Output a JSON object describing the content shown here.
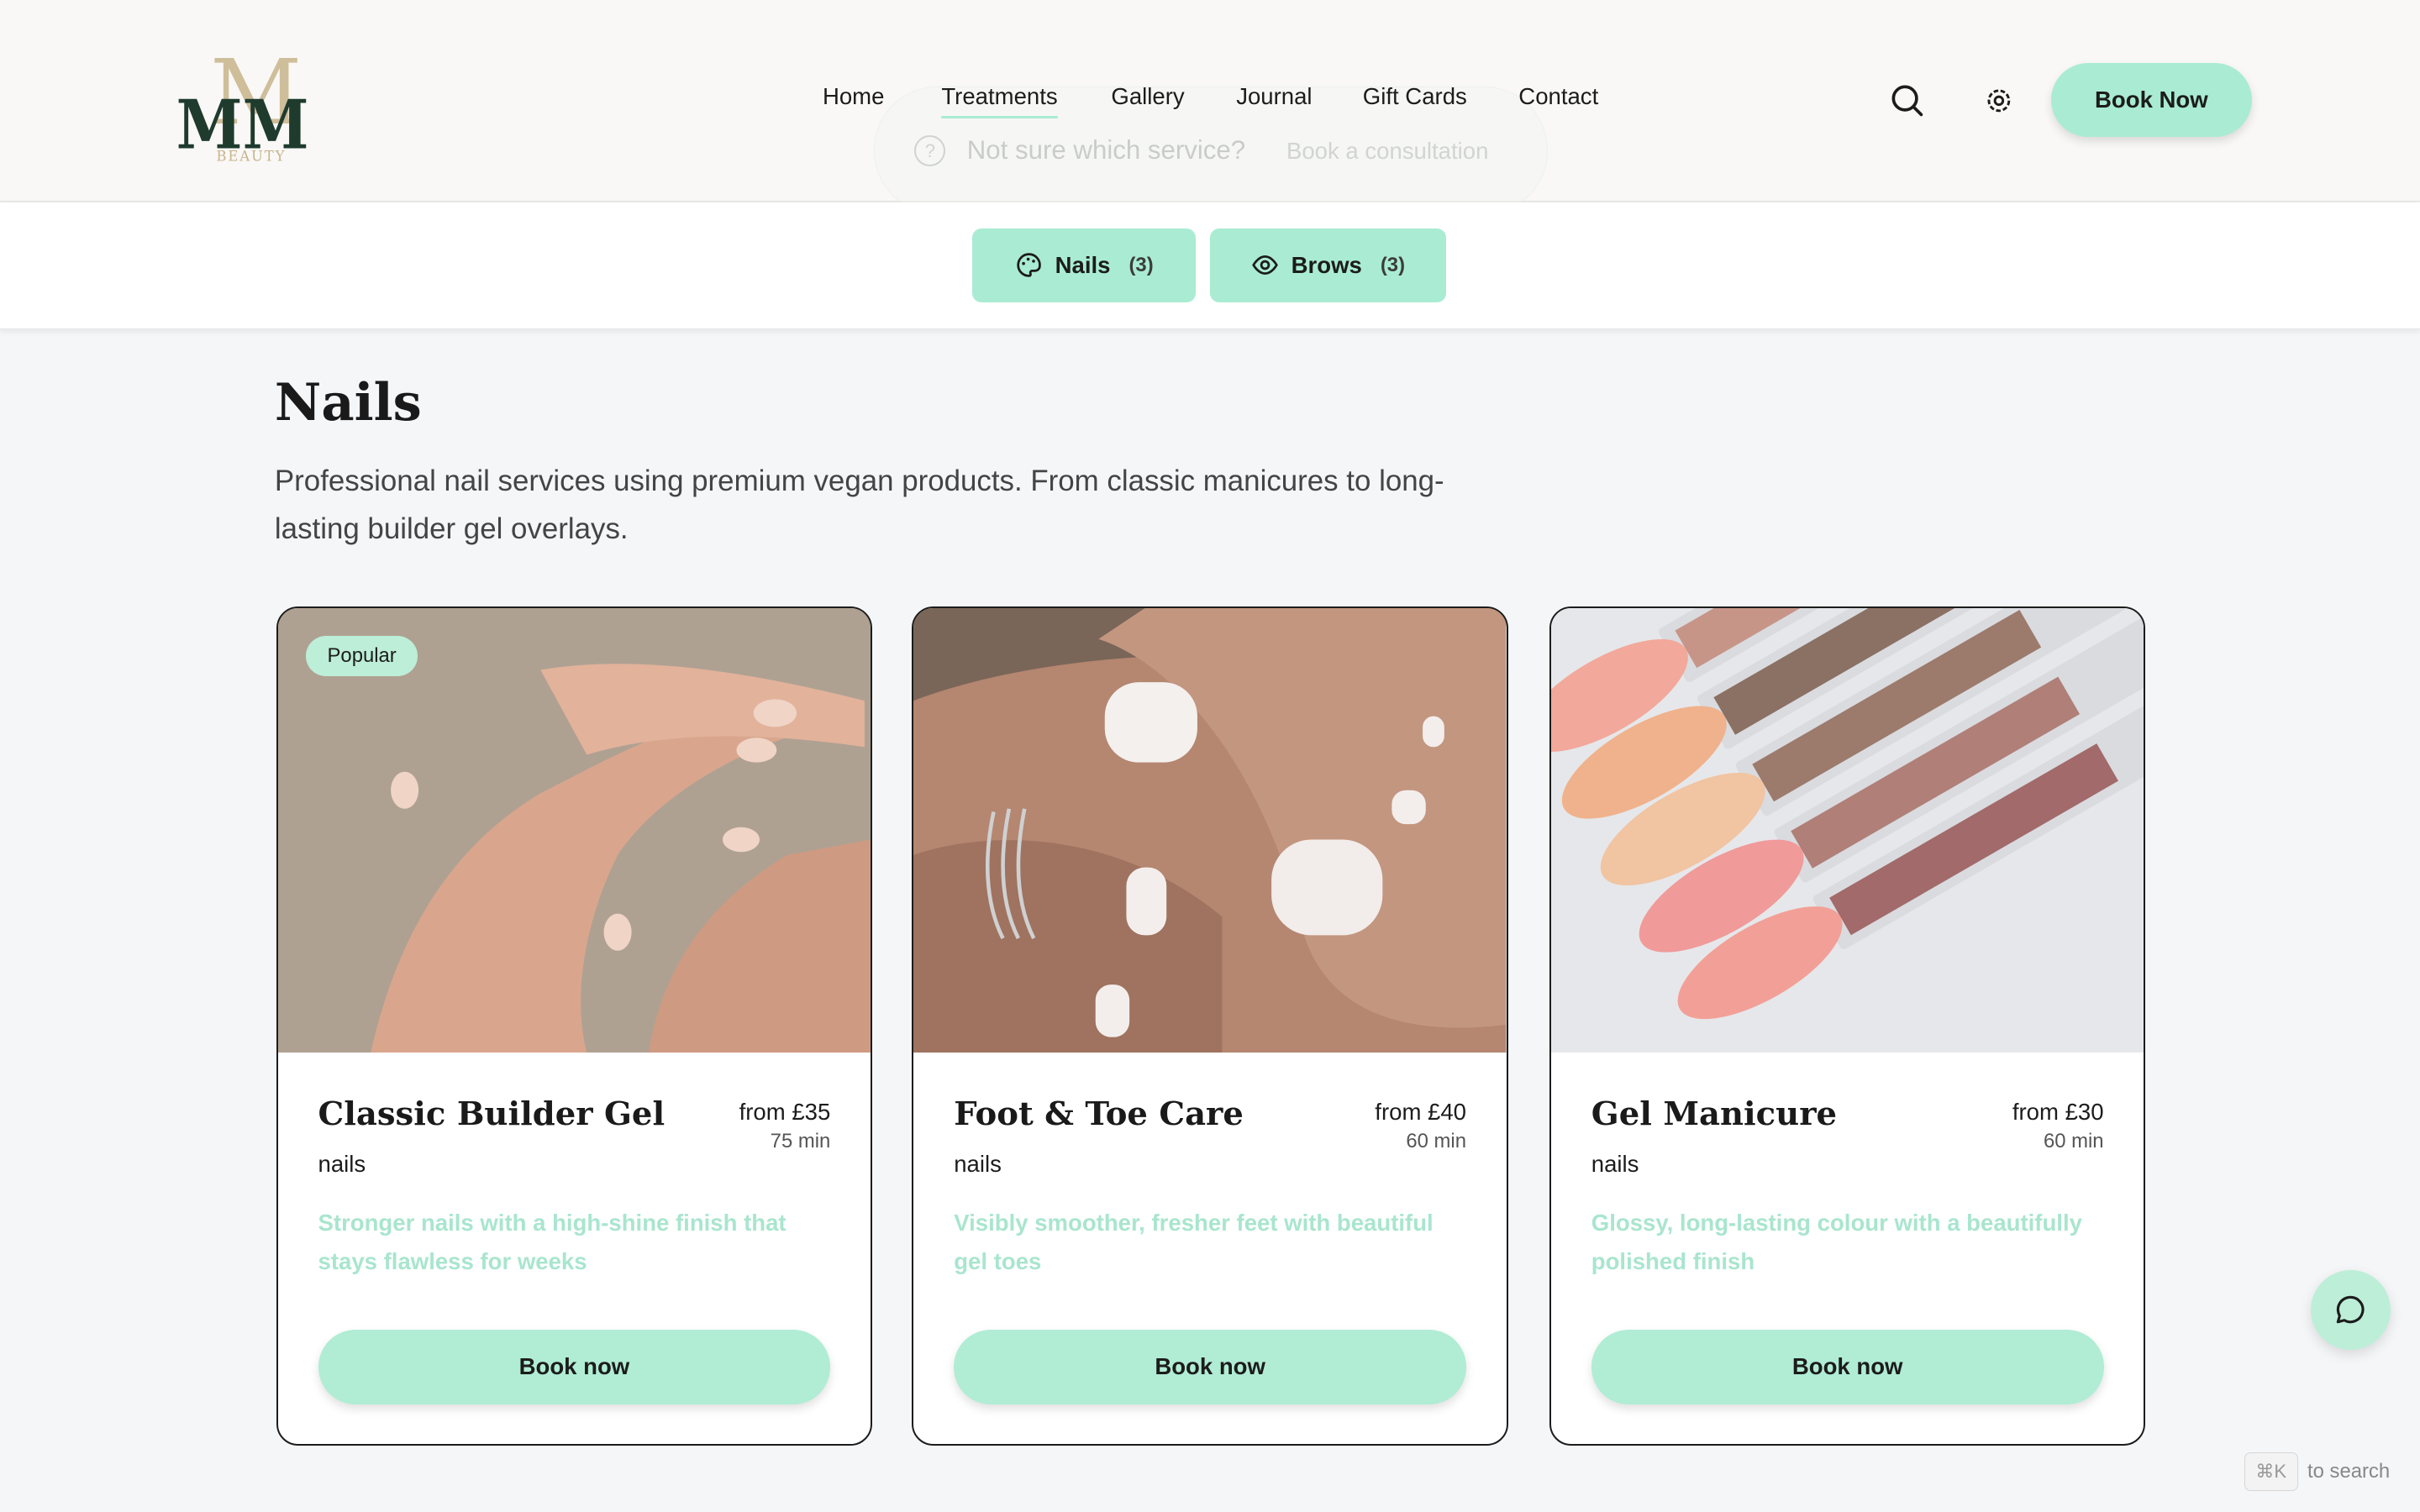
{
  "header": {
    "logo_text": "MM",
    "logo_subtext": "BEAUTY",
    "nav": [
      {
        "label": "Home",
        "active": false
      },
      {
        "label": "Treatments",
        "active": true
      },
      {
        "label": "Gallery",
        "active": false
      },
      {
        "label": "Journal",
        "active": false
      },
      {
        "label": "Gift Cards",
        "active": false
      },
      {
        "label": "Contact",
        "active": false
      }
    ],
    "consult_title": "Not sure which service?",
    "consult_link": "Book a consultation",
    "search_icon": "search-icon",
    "settings_icon": "gear-icon",
    "book_now_label": "Book Now"
  },
  "tabs": [
    {
      "label": "Nails",
      "count": "(3)",
      "icon": "palette-icon"
    },
    {
      "label": "Brows",
      "count": "(3)",
      "icon": "eye-icon"
    }
  ],
  "section": {
    "title": "Nails",
    "description": "Professional nail services using premium vegan products. From classic manicures to long-lasting builder gel overlays."
  },
  "cards": [
    {
      "badge": "Popular",
      "name": "Classic Builder Gel",
      "price": "from £35",
      "duration": "75 min",
      "category": "nails",
      "description": "Stronger nails with a high-shine finish that stays flawless for weeks",
      "button": "Book now"
    },
    {
      "badge": "",
      "name": "Foot & Toe Care",
      "price": "from £40",
      "duration": "60 min",
      "category": "nails",
      "description": "Visibly smoother, fresher feet with beautiful gel toes",
      "button": "Book now"
    },
    {
      "badge": "",
      "name": "Gel Manicure",
      "price": "from £30",
      "duration": "60 min",
      "category": "nails",
      "description": "Glossy, long-lasting colour with a beautifully polished finish",
      "button": "Book now"
    }
  ],
  "chat_icon": "chat-bubble-icon",
  "search_hint": {
    "key": "⌘K",
    "text": "to search"
  },
  "colors": {
    "accent": "#a9ecd3",
    "text": "#1c1c1c",
    "card_desc": "#a9e5cf",
    "logo_green": "#1f3b2e",
    "logo_gold": "#c8b48a"
  }
}
